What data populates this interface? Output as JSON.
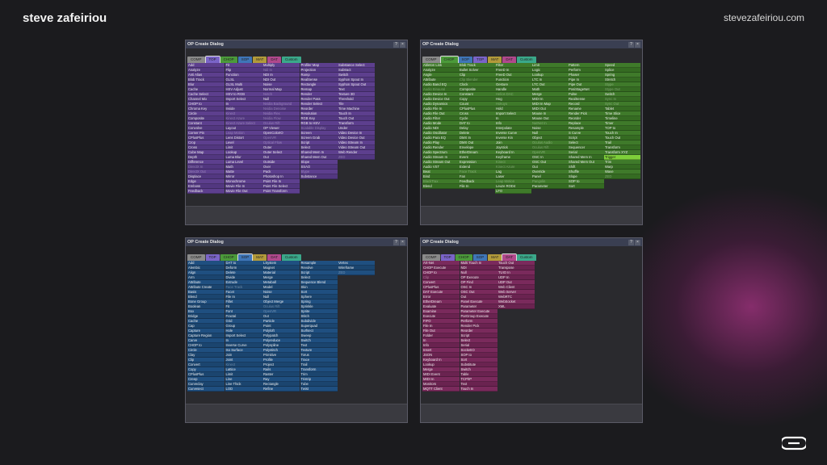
{
  "header": {
    "author": "steve zafeiriou",
    "site": "stevezafeiriou.com"
  },
  "dialogs": [
    {
      "title": "OP Create Dialog",
      "active_tab": "TOP",
      "color": "#5d3f8e",
      "alt_color": "#523780",
      "tabs": [
        {
          "label": "COMP",
          "color": "#8a8a8a"
        },
        {
          "label": "TOP",
          "color": "#7a64c8"
        },
        {
          "label": "CHOP",
          "color": "#4b9a3a"
        },
        {
          "label": "SOP",
          "color": "#3f76b8"
        },
        {
          "label": "MAT",
          "color": "#b29a3a"
        },
        {
          "label": "DAT",
          "color": "#b0488c"
        },
        {
          "label": "Custom",
          "color": "#3aa88a"
        }
      ],
      "columns": [
        [
          "Add",
          "Analyze",
          "Anti Alias",
          "Blob Track",
          "Blur",
          "Cache",
          "Cache Select",
          "Channel Mix",
          "CHOP to",
          "Chroma Key",
          "Circle",
          "Composite",
          "Constant",
          "Convolve",
          "Corner Pin",
          "CPlusPlus",
          "Crop",
          "Cross",
          "Cube Map",
          "Depth",
          "Difference",
          "DirectX In",
          "DirectX Out",
          "Displace",
          "Edge",
          "Emboss",
          "Feedback"
        ],
        [
          "Fit",
          "Flip",
          "Function",
          "GLSL",
          "GLSL Multi",
          "HSV Adjust",
          "HSV to RGB",
          "Import Select",
          "In",
          "Inside",
          "Kinect",
          "Kinect Azure",
          "Kinect Azure Select",
          "Layout",
          "Leap Motion",
          "Lens Distort",
          "Level",
          "Limit",
          "Lookup",
          "Luma Blur",
          "Luma Level",
          "Math",
          "Matte",
          "Mirror",
          "Monochrome",
          "Movie File In",
          "Movie File Out"
        ],
        [
          "Multiply",
          "Ndi In",
          "NDI In",
          "NDI Out",
          "Noise",
          "Normal Map",
          "Notch",
          "Null",
          "Nvidia Background",
          "Nvidia Denoise",
          "Nvidia Flex",
          "Nvidia Flow",
          "Oculus Rift",
          "OP Viewer",
          "OpenColorIO",
          "OpenVR",
          "Optical Flow",
          "Outer",
          "Outer Select",
          "Out",
          "Outside",
          "Over",
          "Pack",
          "Photoshop In",
          "Point File In",
          "Point File Select",
          "Point Transform"
        ],
        [
          "Profiler Map",
          "Projection",
          "Ramp",
          "RealSense",
          "Rectangle",
          "Remap",
          "Render",
          "Render Pass",
          "Render Select",
          "Reorder",
          "Resolution",
          "RGB Key",
          "RGB to HSV",
          "Scalable Display",
          "Screen",
          "Screen Grab",
          "Script",
          "Select",
          "Shared Mem In",
          "Shared Mem Out",
          "Slope",
          "SSAO",
          "Stype",
          "Substance"
        ],
        [
          "Substance Select",
          "Subtract",
          "Switch",
          "Syphon Spout In",
          "Syphon Spout Out",
          "Text",
          "Texture 3D",
          "Threshold",
          "Tile",
          "Time Machine",
          "Touch In",
          "Touch Out",
          "Transform",
          "Under",
          "Video Device In",
          "Video Device Out",
          "Video Stream In",
          "Video Stream Out",
          "Web Render",
          "ZED"
        ]
      ],
      "dim": [
        "DirectX In",
        "DirectX Out",
        "Kinect",
        "Kinect Azure",
        "Kinect Azure Select",
        "Leap Motion",
        "Ndi In",
        "Notch",
        "Nvidia Background",
        "Nvidia Denoise",
        "Nvidia Flex",
        "Nvidia Flow",
        "Oculus Rift",
        "OpenVR",
        "Optical Flow",
        "Scalable Display",
        "Stype",
        "ZED"
      ],
      "highlight": []
    },
    {
      "title": "OP Create Dialog",
      "active_tab": "CHOP",
      "color": "#3f7a2a",
      "alt_color": "#356b22",
      "tabs": [
        {
          "label": "COMP",
          "color": "#8a8a8a"
        },
        {
          "label": "CHOP",
          "color": "#4b9a3a"
        },
        {
          "label": "SOP",
          "color": "#3f76b8"
        },
        {
          "label": "TOP",
          "color": "#7a64c8"
        },
        {
          "label": "MAT",
          "color": "#b29a3a"
        },
        {
          "label": "DAT",
          "color": "#b0488c"
        },
        {
          "label": "Custom",
          "color": "#3aa88a"
        }
      ],
      "columns": [
        [
          "Ableton Link",
          "Analyze",
          "Angle",
          "Attribute",
          "Audio Band EQ",
          "Audio Binaural",
          "Audio Device In",
          "Audio Device Out",
          "Audio Dynamics",
          "Audio File In",
          "Audio File Out",
          "Audio Filter",
          "Audio Mode",
          "Audio NDI",
          "Audio Oscillator",
          "Audio Para EQ",
          "Audio Play",
          "Audio Render",
          "Audio Spectrum",
          "Audio Stream In",
          "Audio Stream Out",
          "Audio VST",
          "Beat",
          "Bind",
          "BlackTrax",
          "Blend"
        ],
        [
          "Blob Track",
          "Bullet Solver",
          "Clip",
          "Clip Blender",
          "Clock",
          "Composite",
          "Constant",
          "Copy",
          "Count",
          "CPlusPlus",
          "Cross",
          "Cycle",
          "DAT to",
          "Delay",
          "Delete",
          "DMX In",
          "DMX Out",
          "Envelope",
          "EtherDream",
          "Event",
          "Expression",
          "Extend",
          "Face Track",
          "Fan",
          "Feedback",
          "File In"
        ],
        [
          "Filter",
          "FreeD In",
          "FreeD Out",
          "Function",
          "Gesture",
          "Handle",
          "Helios DAC",
          "Hog",
          "Hokuyo",
          "Hold",
          "Import Select",
          "In",
          "Info",
          "Interpolate",
          "Inverse Curve",
          "Inverse Kin",
          "Join",
          "Joystick",
          "Keyboard In",
          "Keyframe",
          "Kinect",
          "Kinect Azure",
          "Lag",
          "Laser",
          "Leap Motion",
          "Leuze ROD4",
          "LFO"
        ],
        [
          "Limit",
          "Logic",
          "Lookup",
          "LTC In",
          "LTC Out",
          "Math",
          "Merge",
          "MIDI In",
          "MIDI In Map",
          "MIDI Out",
          "Mouse In",
          "Mouse Out",
          "NatNet In",
          "Noise",
          "Null",
          "Object",
          "Oculus Audio",
          "Oculus Rift",
          "OpenVR",
          "OSC In",
          "OSC Out",
          "Out",
          "Override",
          "Panel",
          "Pangolin",
          "Parameter"
        ],
        [
          "Pattern",
          "Perform",
          "Phaser",
          "Pipe In",
          "Pipe Out",
          "PosiStageNet",
          "Pulse",
          "RealSense",
          "Record",
          "Rename",
          "Render Pick",
          "Reorder",
          "Replace",
          "Resample",
          "S Curve",
          "Script",
          "Select",
          "Sequencer",
          "Serial",
          "Shared Mem In",
          "Shared Mem Out",
          "Shift",
          "Shuffle",
          "Slope",
          "SOP to",
          "Sort"
        ],
        [
          "Speed",
          "Splice",
          "Spring",
          "Stretch",
          "Stype",
          "Stype Out",
          "Switch",
          "Sync In",
          "Sync Out",
          "Tablet",
          "Time Slice",
          "Timeline",
          "Timer",
          "TOP to",
          "Touch In",
          "Touch Out",
          "Trail",
          "Transform",
          "Transform XYZ",
          "Trigger",
          "Trim",
          "Warp",
          "Wave",
          "ZED"
        ]
      ],
      "dim": [
        "Clip Blender",
        "Audio Binaural",
        "Face Track",
        "Helios DAC",
        "Hokuyo",
        "Kinect",
        "Kinect Azure",
        "Leap Motion",
        "Oculus Audio",
        "Oculus Rift",
        "OpenVR",
        "Pangolin",
        "Stype",
        "Stype Out",
        "Sync In",
        "Sync Out",
        "ZED",
        "BlackTrax",
        "NatNet In"
      ],
      "highlight": [
        "Trigger"
      ]
    },
    {
      "title": "OP Create Dialog",
      "active_tab": "SOP",
      "color": "#1f4f80",
      "alt_color": "#1b456f",
      "tabs": [
        {
          "label": "COMP",
          "color": "#8a8a8a"
        },
        {
          "label": "TOP",
          "color": "#7a64c8"
        },
        {
          "label": "CHOP",
          "color": "#4b9a3a"
        },
        {
          "label": "SOP",
          "color": "#3f76b8"
        },
        {
          "label": "MAT",
          "color": "#b29a3a"
        },
        {
          "label": "DAT",
          "color": "#b0488c"
        },
        {
          "label": "Custom",
          "color": "#3aa88a"
        }
      ],
      "columns": [
        [
          "Add",
          "Alembic",
          "Align",
          "Arm",
          "Attribute",
          "Attribute Create",
          "Basis",
          "Blend",
          "Bone Group",
          "Boolean",
          "Box",
          "Bridge",
          "Cache",
          "Cap",
          "Capture",
          "Capture Region",
          "Carve",
          "CHOP to",
          "Circle",
          "Clay",
          "Clip",
          "Convert",
          "Copy",
          "CPlusPlus",
          "Creep",
          "Curveclay",
          "Curvesect"
        ],
        [
          "DAT to",
          "Deform",
          "Delete",
          "Divide",
          "Extrude",
          "Face Track",
          "Facet",
          "File In",
          "Fillet",
          "Fit",
          "Font",
          "Fractal",
          "Grid",
          "Group",
          "Hole",
          "Import Select",
          "In",
          "Inverse Curve",
          "Iso Surface",
          "Join",
          "Joint",
          "Kinect",
          "Lattice",
          "Limit",
          "Line",
          "Line Thick",
          "LOD"
        ],
        [
          "LSystem",
          "Magnet",
          "Material",
          "Merge",
          "Metaball",
          "Model",
          "Noise",
          "Null",
          "Object Merge",
          "Oculus Rift",
          "OpenVR",
          "Out",
          "Particle",
          "Point",
          "Polyloft",
          "Polypatch",
          "Polyreduce",
          "Polyspline",
          "Polystitch",
          "Primitive",
          "Profile",
          "Project",
          "Rails",
          "Raster",
          "Ray",
          "Rectangle",
          "Refine"
        ],
        [
          "Resample",
          "Revolve",
          "Script",
          "Select",
          "Sequence Blend",
          "Skin",
          "Sort",
          "Sphere",
          "Spring",
          "Sprinkle",
          "Sprite",
          "Stitch",
          "Subdivide",
          "Superquad",
          "Surfsect",
          "Sweep",
          "Switch",
          "Text",
          "Texture",
          "Torus",
          "Trace",
          "Trail",
          "Transform",
          "Trim",
          "Tristrip",
          "Tube",
          "Twist"
        ],
        [
          "Vertex",
          "Wireframe",
          "ZED"
        ]
      ],
      "dim": [
        "Face Track",
        "Kinect",
        "Oculus Rift",
        "OpenVR",
        "ZED"
      ],
      "highlight": []
    },
    {
      "title": "OP Create Dialog",
      "active_tab": "DAT",
      "color": "#7a2a5c",
      "alt_color": "#6a2350",
      "tabs": [
        {
          "label": "COMP",
          "color": "#8a8a8a"
        },
        {
          "label": "TOP",
          "color": "#7a64c8"
        },
        {
          "label": "CHOP",
          "color": "#4b9a3a"
        },
        {
          "label": "SOP",
          "color": "#3f76b8"
        },
        {
          "label": "MAT",
          "color": "#b29a3a"
        },
        {
          "label": "DAT",
          "color": "#b0488c"
        },
        {
          "label": "Custom",
          "color": "#3aa88a"
        }
      ],
      "columns": [
        [
          "Art-Net",
          "CHOP Execute",
          "CHOP to",
          "Clip",
          "Convert",
          "CPlusPlus",
          "DAT Execute",
          "Error",
          "EtherDream",
          "Evaluate",
          "Examine",
          "Execute",
          "FIFO",
          "File In",
          "File Out",
          "Folder",
          "In",
          "Info",
          "Insert",
          "JSON",
          "Keyboard In",
          "Lookup",
          "Merge",
          "MIDI Event",
          "MIDI In",
          "Monitors",
          "MQTT Client"
        ],
        [
          "Multi Touch In",
          "NDI",
          "Null",
          "OP Execute",
          "OP Find",
          "OSC In",
          "OSC Out",
          "Out",
          "Panel Execute",
          "Parameter",
          "Parameter Execute",
          "ParGroup Execute",
          "Perform",
          "Render Pick",
          "Reorder",
          "Script",
          "Select",
          "Serial",
          "SocketIO",
          "SOP to",
          "Sort",
          "Substitute",
          "Switch",
          "Table",
          "TCP/IP",
          "Text",
          "Touch In"
        ],
        [
          "Touch Out",
          "Transpose",
          "TUIO In",
          "UDP In",
          "UDP Out",
          "Web Client",
          "Web Server",
          "WebRTC",
          "WebSocket",
          "XML"
        ]
      ],
      "dim": [
        "Clip"
      ],
      "highlight": []
    }
  ]
}
